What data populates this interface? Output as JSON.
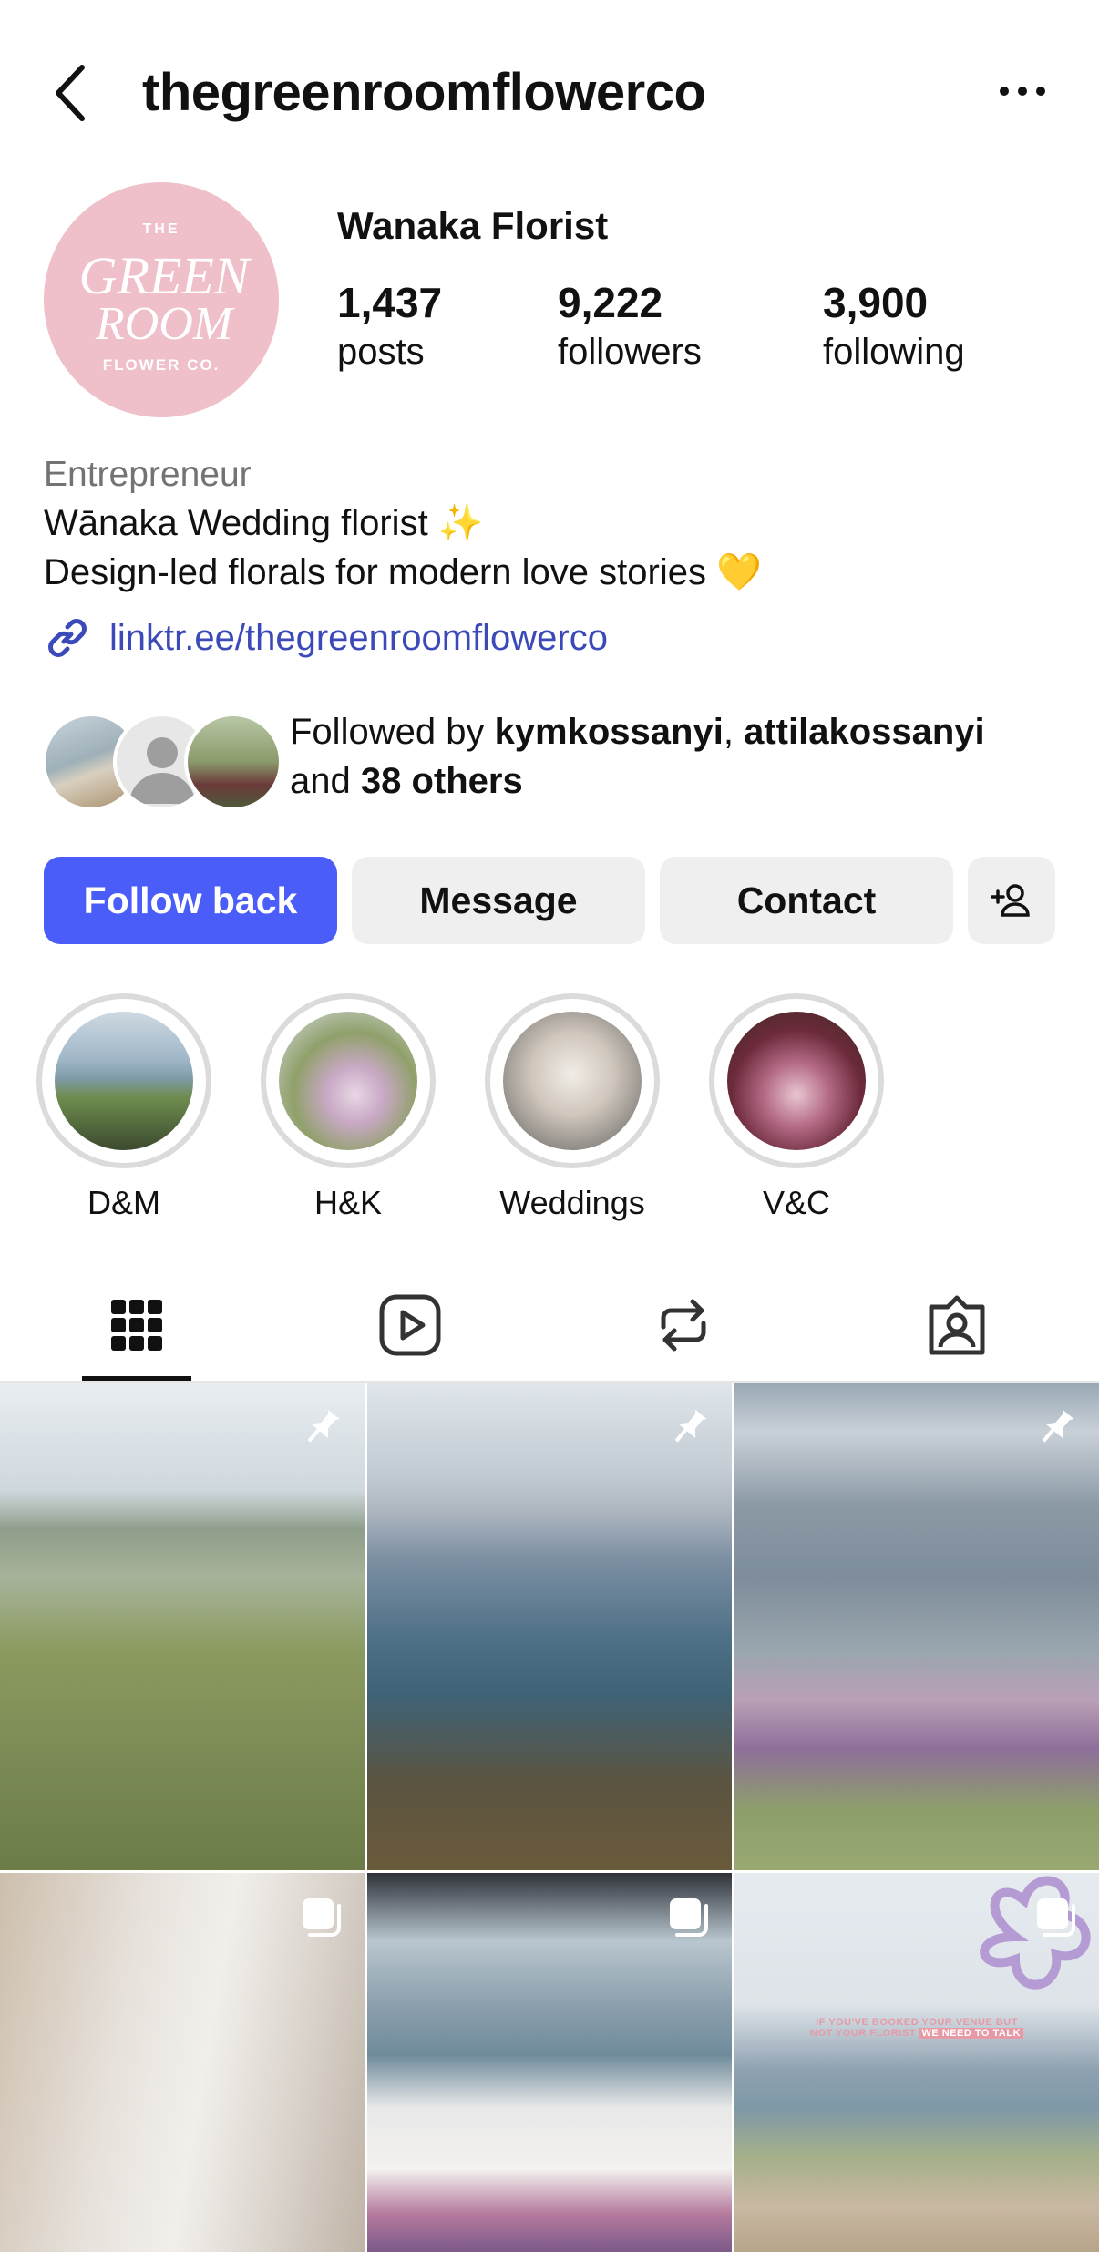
{
  "header": {
    "username": "thegreenroomflowerco",
    "back_icon": "chevron-left-icon",
    "more_icon": "more-horizontal-icon"
  },
  "profile": {
    "avatar_text": {
      "line1": "THE",
      "line2": "GREEN",
      "line3": "ROOM",
      "line4": "FLOWER CO."
    },
    "display_name": "Wanaka Florist",
    "stats": [
      {
        "count": "1,437",
        "label": "posts"
      },
      {
        "count": "9,222",
        "label": "followers"
      },
      {
        "count": "3,900",
        "label": "following"
      }
    ],
    "category": "Entrepreneur",
    "bio_line1": "Wānaka Wedding florist ✨",
    "bio_line2": "Design-led florals for modern love stories 💛",
    "link": "linktr.ee/thegreenroomflowerco",
    "followed_by": {
      "prefix": "Followed by",
      "user1": "kymkossanyi",
      "separator": ",",
      "user2": "attilakossanyi",
      "and": "and",
      "others": "38 others"
    }
  },
  "actions": {
    "follow_back": "Follow back",
    "message": "Message",
    "contact": "Contact",
    "suggest_icon": "add-person-icon"
  },
  "highlights": [
    {
      "label": "D&M"
    },
    {
      "label": "H&K"
    },
    {
      "label": "Weddings"
    },
    {
      "label": "V&C"
    }
  ],
  "tabs": [
    {
      "icon": "grid-icon",
      "active": true
    },
    {
      "icon": "reels-icon",
      "active": false
    },
    {
      "icon": "reposts-icon",
      "active": false
    },
    {
      "icon": "tagged-icon",
      "active": false
    }
  ],
  "grid_posts": [
    {
      "badge": "pin-icon"
    },
    {
      "badge": "pin-icon"
    },
    {
      "badge": "pin-icon"
    },
    {
      "badge": "carousel-icon"
    },
    {
      "badge": "carousel-icon"
    },
    {
      "badge": "carousel-icon",
      "overlay_text_1": "IF YOU'VE BOOKED YOUR VENUE BUT",
      "overlay_text_2": "NOT YOUR FLORIST",
      "overlay_text_3": "WE NEED TO TALK"
    }
  ],
  "colors": {
    "accent": "#4a5df9",
    "avatar_bg": "#efbfca",
    "link": "#3b4ab8",
    "button_bg": "#efefef"
  }
}
